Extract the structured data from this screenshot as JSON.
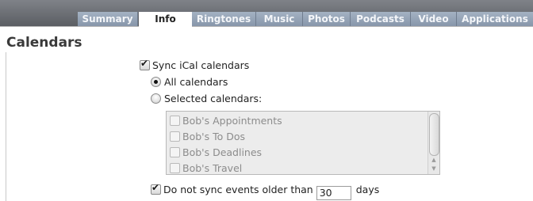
{
  "tabs": [
    {
      "label": "Summary"
    },
    {
      "label": "Info"
    },
    {
      "label": "Ringtones"
    },
    {
      "label": "Music"
    },
    {
      "label": "Photos"
    },
    {
      "label": "Podcasts"
    },
    {
      "label": "Video"
    },
    {
      "label": "Applications"
    }
  ],
  "active_tab": "Info",
  "section_title": "Calendars",
  "sync_ical": {
    "label": "Sync iCal calendars",
    "checked": true
  },
  "radio_all": {
    "label": "All calendars",
    "selected": true
  },
  "radio_selected": {
    "label": "Selected calendars:",
    "selected": false
  },
  "calendar_list": {
    "items": [
      {
        "label": "Bob's Appointments",
        "checked": false
      },
      {
        "label": "Bob's To Dos",
        "checked": false
      },
      {
        "label": "Bob's Deadlines",
        "checked": false
      },
      {
        "label": "Bob's Travel",
        "checked": false
      }
    ]
  },
  "old_events": {
    "label": "Do not sync events older than",
    "checked": true,
    "value": "30",
    "unit": "days"
  }
}
